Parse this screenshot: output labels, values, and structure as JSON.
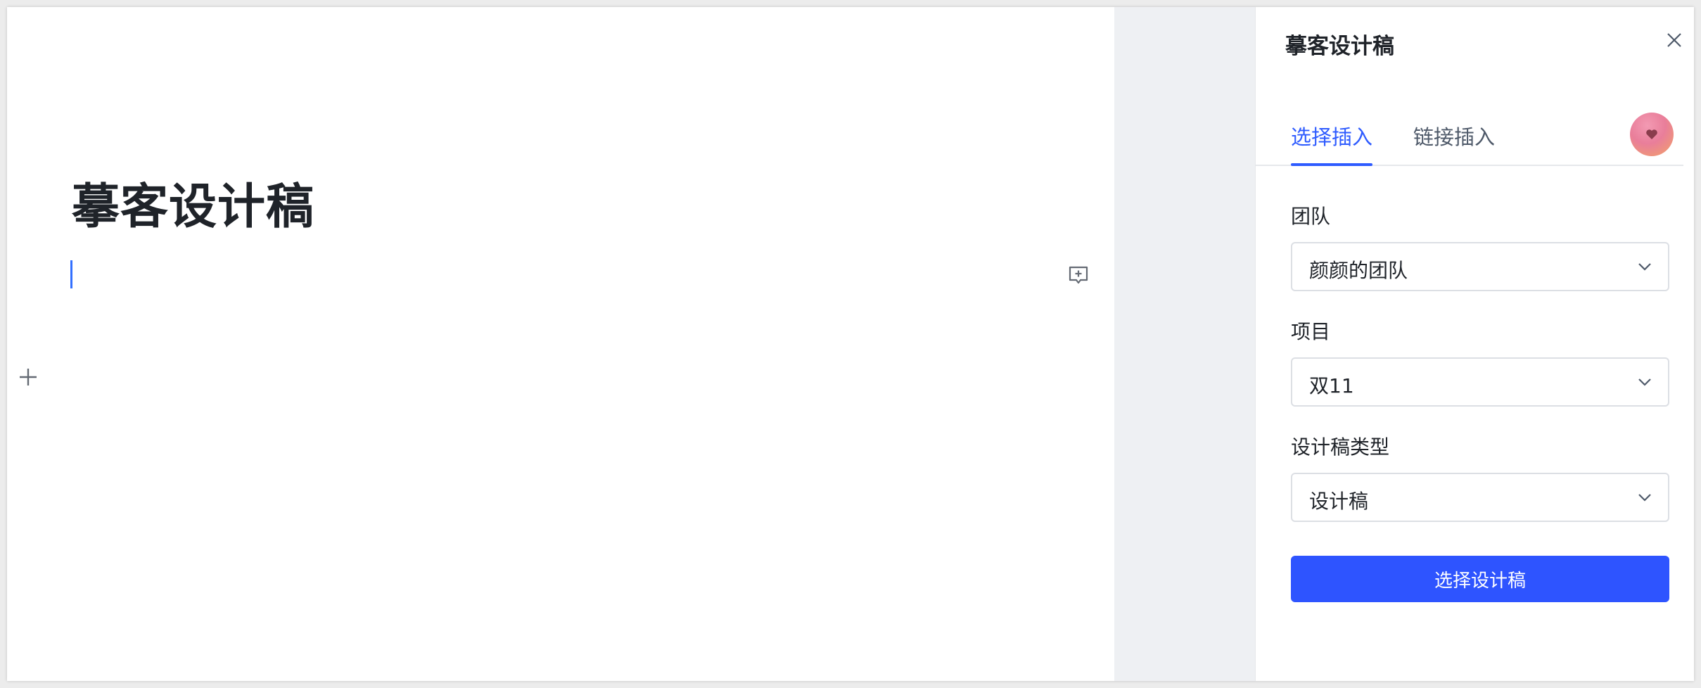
{
  "document": {
    "title": "摹客设计稿"
  },
  "panel": {
    "title": "摹客设计稿",
    "tabs": [
      {
        "label": "选择插入",
        "active": true
      },
      {
        "label": "链接插入",
        "active": false
      }
    ],
    "fields": [
      {
        "label": "团队",
        "value": "颜颜的团队"
      },
      {
        "label": "项目",
        "value": "双11"
      },
      {
        "label": "设计稿类型",
        "value": "设计稿"
      }
    ],
    "submit_label": "选择设计稿"
  },
  "icons": {
    "close": "close-icon",
    "comment": "comment-add-icon",
    "add_block": "plus-icon",
    "select_arrow": "chevron-down-icon"
  },
  "colors": {
    "accent": "#2e5bff",
    "button": "#2e54ff",
    "gutter": "#eef0f3",
    "caret": "#3370ff"
  }
}
